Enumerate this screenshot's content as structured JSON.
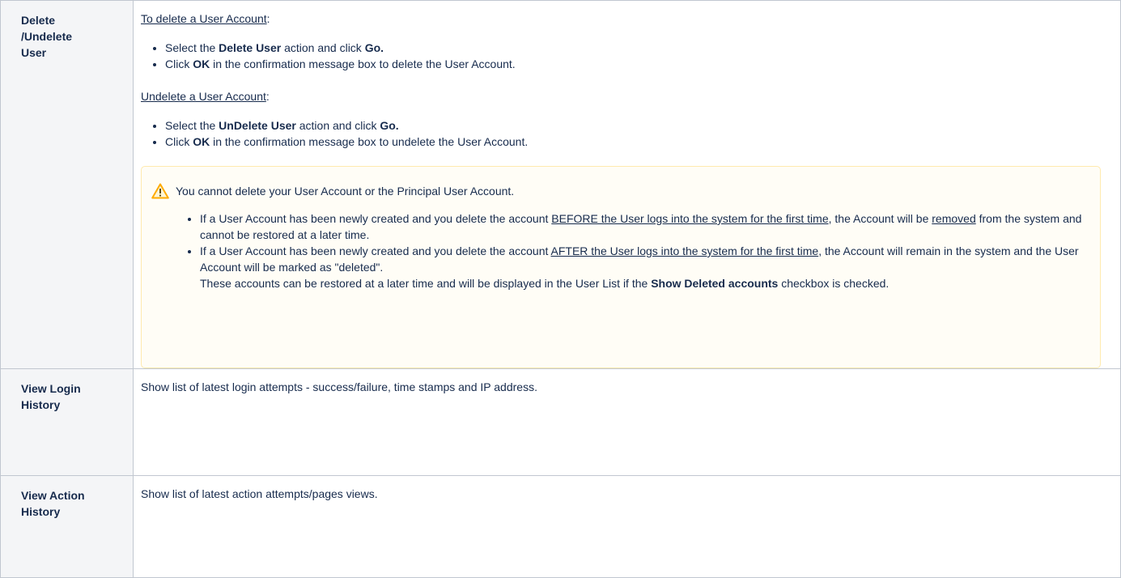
{
  "rows": [
    {
      "header": "Delete /Undelete User",
      "delete_section": {
        "title": "To delete a User Account",
        "title_suffix": ":",
        "steps": [
          {
            "pre": "Select the ",
            "bold": "Delete User",
            "mid": " action and click ",
            "bold2": "Go.",
            "post": ""
          },
          {
            "pre": "Click ",
            "bold": "OK",
            "mid": " in the confirmation message box to delete the User Account.",
            "bold2": "",
            "post": ""
          }
        ]
      },
      "undelete_section": {
        "title": "Undelete a User Account",
        "title_suffix": ":",
        "steps": [
          {
            "pre": "Select the ",
            "bold": "UnDelete User",
            "mid": " action and click ",
            "bold2": "Go.",
            "post": ""
          },
          {
            "pre": "Click ",
            "bold": "OK",
            "mid": " in the confirmation message box to undelete the User Account.",
            "bold2": "",
            "post": ""
          }
        ]
      },
      "warning": {
        "icon": "warning-triangle-icon",
        "message": "You cannot delete your User Account or the Principal User Account.",
        "bullets": [
          {
            "pre": "If a User Account has been newly created and you delete the account ",
            "underlined": "BEFORE the User logs into the system for the first time",
            "mid": ", the Account will be ",
            "underlined2": "removed",
            "post": " from the system and cannot be restored at a later time."
          },
          {
            "pre": "If a User Account has been newly created and you delete the account ",
            "underlined": "AFTER the User logs into the system for the first time",
            "mid": ", the Account will remain in the system and the User Account will be marked as \"deleted\".",
            "line2_pre": "These accounts can be restored at a later time and will be displayed in the User List if the ",
            "line2_bold": "Show Deleted accounts",
            "line2_post": " checkbox is checked."
          }
        ]
      }
    },
    {
      "header": "View Login History",
      "text": "Show list of latest login attempts - success/failure, time stamps and IP address."
    },
    {
      "header": "View Action History",
      "text": "Show list of latest action attempts/pages views."
    }
  ],
  "colors": {
    "header_bg": "#f4f5f7",
    "border": "#c1c7d0",
    "warning_bg": "#fffdf6",
    "warning_border": "#ffeaae",
    "warning_icon": "#ffab00"
  }
}
